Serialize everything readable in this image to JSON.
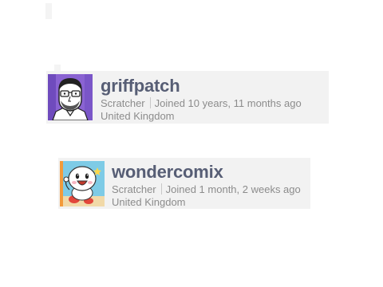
{
  "profiles": [
    {
      "username": "griffpatch",
      "role": "Scratcher",
      "joined": "Joined 10 years, 11 months ago",
      "location": "United Kingdom",
      "avatar_icon": "man-with-glasses-avatar"
    },
    {
      "username": "wondercomix",
      "role": "Scratcher",
      "joined": "Joined 1 month, 2 weeks ago",
      "location": "United Kingdom",
      "avatar_icon": "cartoon-character-avatar"
    }
  ],
  "colors": {
    "card_background": "#f2f2f2",
    "username_text": "#575e75",
    "meta_text": "#8c8c8c",
    "avatar1_background": "#8a63d2",
    "avatar2_background": "#7ecbe6"
  }
}
